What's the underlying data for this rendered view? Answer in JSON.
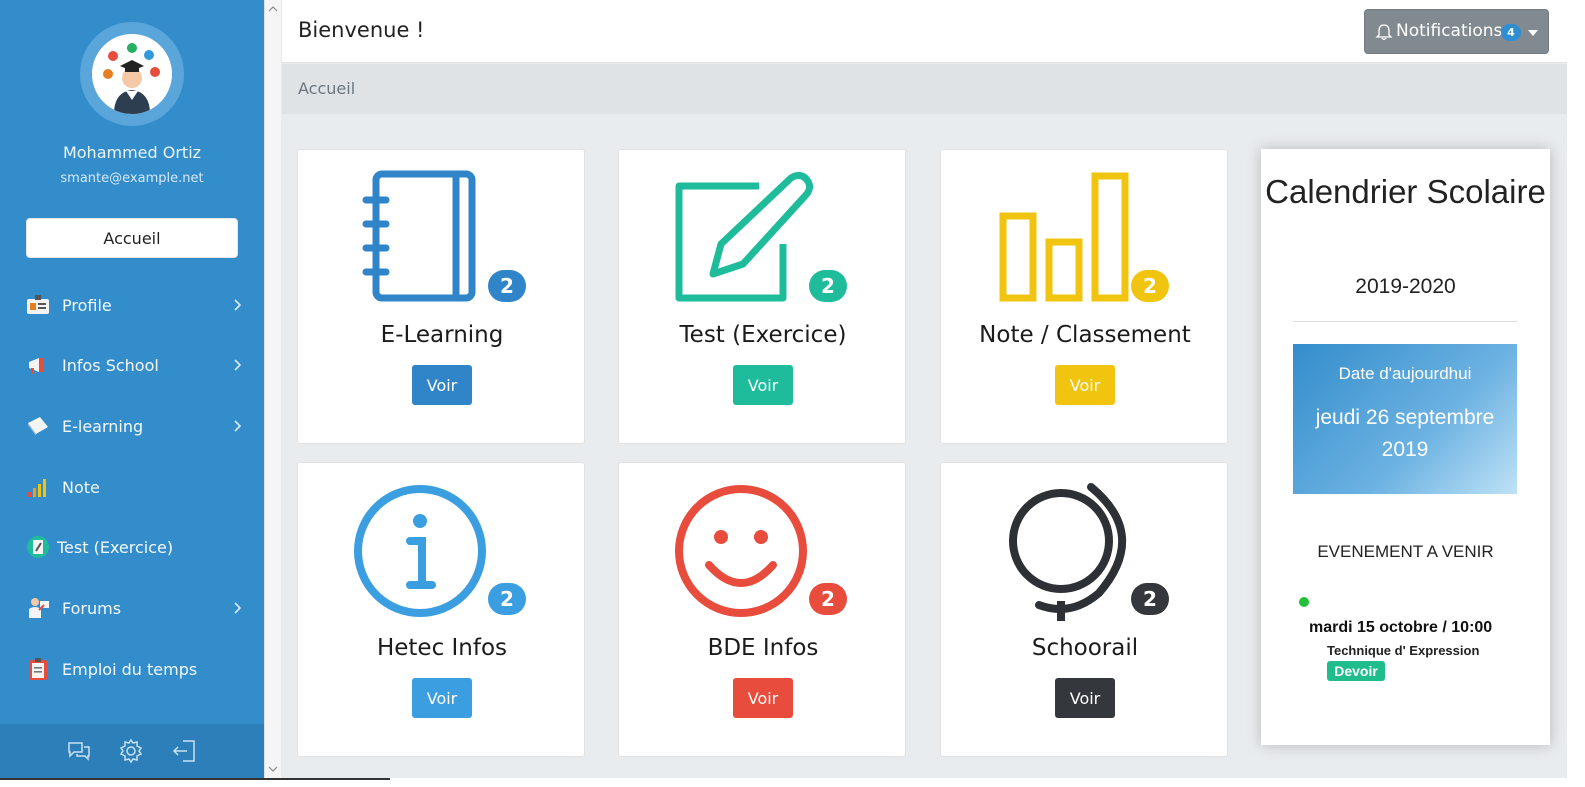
{
  "sidebar": {
    "user_name": "Mohammed Ortiz",
    "user_email": "smante@example.net",
    "home_button": "Accueil",
    "items": [
      {
        "label": "Profile",
        "icon": "id-card-icon",
        "has_submenu": true
      },
      {
        "label": "Infos School",
        "icon": "megaphone-icon",
        "has_submenu": true
      },
      {
        "label": "E-learning",
        "icon": "book-icon",
        "has_submenu": true
      },
      {
        "label": "Note",
        "icon": "signal-bars-icon",
        "has_submenu": false
      },
      {
        "label": "Test (Exercice)",
        "icon": "pencil-icon",
        "has_submenu": false
      },
      {
        "label": "Forums",
        "icon": "teacher-icon",
        "has_submenu": true
      },
      {
        "label": "Emploi du temps",
        "icon": "clipboard-icon",
        "has_submenu": false
      }
    ],
    "footer_icons": [
      "chat-icon",
      "gear-icon",
      "logout-icon"
    ]
  },
  "header": {
    "title": "Bienvenue !",
    "notifications_label": "Notifications",
    "notifications_count": "4"
  },
  "breadcrumb": "Accueil",
  "cards": [
    {
      "title": "E-Learning",
      "badge": "2",
      "button": "Voir",
      "icon": "notebook-icon",
      "color": "#2f85c7"
    },
    {
      "title": "Test (Exercice)",
      "badge": "2",
      "button": "Voir",
      "icon": "edit-icon",
      "color": "#1fbc9c"
    },
    {
      "title": "Note / Classement",
      "badge": "2",
      "button": "Voir",
      "icon": "bar-chart-icon",
      "color": "#f1c40f"
    },
    {
      "title": "Hetec Infos",
      "badge": "2",
      "button": "Voir",
      "icon": "info-icon",
      "color": "#3a9ee0"
    },
    {
      "title": "BDE Infos",
      "badge": "2",
      "button": "Voir",
      "icon": "smile-icon",
      "color": "#e74c3c"
    },
    {
      "title": "Schoorail",
      "badge": "2",
      "button": "Voir",
      "icon": "globe-icon",
      "color": "#34373b"
    }
  ],
  "calendar": {
    "title": "Calendrier Scolaire",
    "year": "2019-2020",
    "today_label": "Date d'aujourdhui",
    "today_date": "jeudi 26 septembre 2019",
    "events_heading": "EVENEMENT A VENIR",
    "events": [
      {
        "date": "mardi 15 octobre / 10:00",
        "subject": "Technique d' Expression",
        "tag": "Devoir",
        "status_color": "#21c13a"
      }
    ]
  }
}
